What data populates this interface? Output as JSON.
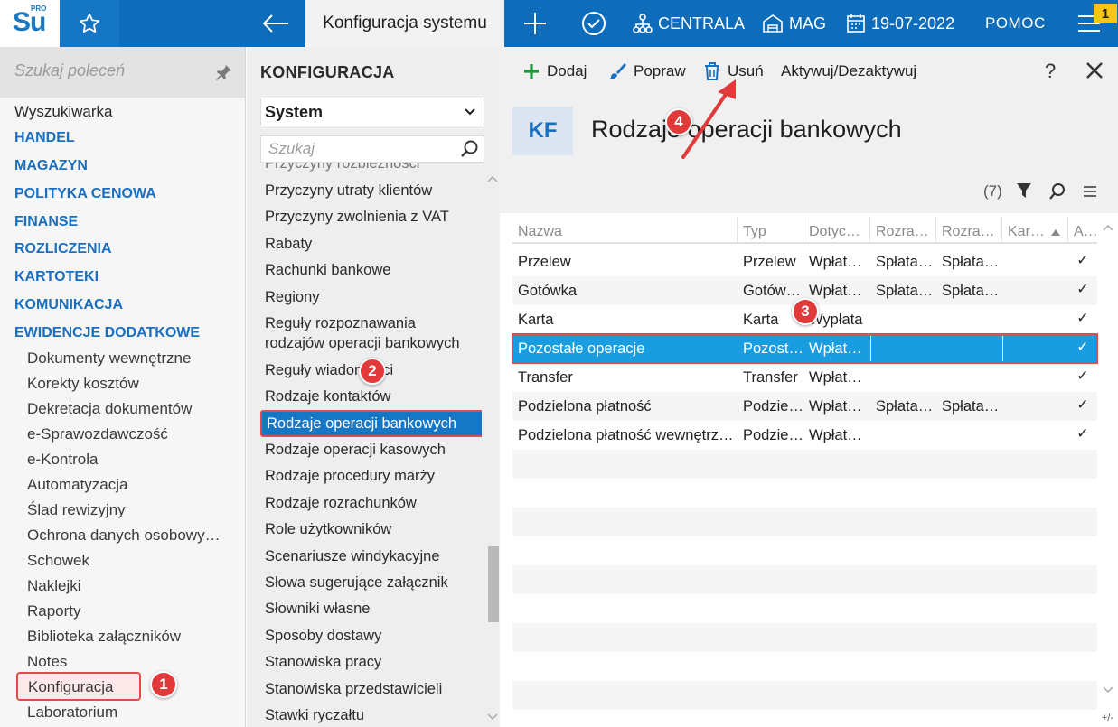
{
  "topbar": {
    "logo_text": "Su",
    "logo_superscript": "PRO",
    "title": "Konfiguracja systemu",
    "centrala": "CENTRALA",
    "mag": "MAG",
    "date": "19-07-2022",
    "help": "POMOC",
    "notification_count": "1"
  },
  "sidebar": {
    "search_placeholder": "Szukaj poleceń",
    "items": [
      {
        "label": "Wyszukiwarka"
      },
      {
        "label": "HANDEL"
      },
      {
        "label": "MAGAZYN"
      },
      {
        "label": "POLITYKA CENOWA"
      },
      {
        "label": "FINANSE"
      },
      {
        "label": "ROZLICZENIA"
      },
      {
        "label": "KARTOTEKI"
      },
      {
        "label": "KOMUNIKACJA"
      },
      {
        "label": "EWIDENCJE DODATKOWE"
      },
      {
        "label": "Dokumenty wewnętrzne"
      },
      {
        "label": "Korekty kosztów"
      },
      {
        "label": "Dekretacja dokumentów"
      },
      {
        "label": "e-Sprawozdawczość"
      },
      {
        "label": "e-Kontrola"
      },
      {
        "label": "Automatyzacja"
      },
      {
        "label": "Ślad rewizyjny"
      },
      {
        "label": "Ochrona danych osobowy…"
      },
      {
        "label": "Schowek"
      },
      {
        "label": "Naklejki"
      },
      {
        "label": "Raporty"
      },
      {
        "label": "Biblioteka załączników"
      },
      {
        "label": "Notes"
      },
      {
        "label": "Konfiguracja"
      },
      {
        "label": "Laboratorium"
      }
    ]
  },
  "config": {
    "title": "KONFIGURACJA",
    "selected_group": "System",
    "search_placeholder": "Szukaj",
    "items": [
      {
        "label": "Przyczyny rozbieżności"
      },
      {
        "label": "Przyczyny utraty klientów"
      },
      {
        "label": "Przyczyny zwolnienia z VAT"
      },
      {
        "label": "Rabaty"
      },
      {
        "label": "Rachunki bankowe"
      },
      {
        "label": "Regiony"
      },
      {
        "label": "Reguły rozpoznawania"
      },
      {
        "label": "rodzajów operacji bankowych"
      },
      {
        "label": "Reguły wiadomości"
      },
      {
        "label": "Rodzaje kontaktów"
      },
      {
        "label": "Rodzaje operacji bankowych"
      },
      {
        "label": "Rodzaje operacji kasowych"
      },
      {
        "label": "Rodzaje procedury marży"
      },
      {
        "label": "Rodzaje rozrachunków"
      },
      {
        "label": "Role użytkowników"
      },
      {
        "label": "Scenariusze windykacyjne"
      },
      {
        "label": "Słowa sugerujące załącznik"
      },
      {
        "label": "Słowniki własne"
      },
      {
        "label": "Sposoby dostawy"
      },
      {
        "label": "Stanowiska pracy"
      },
      {
        "label": "Stanowiska przedstawicieli"
      },
      {
        "label": "Stawki ryczałtu"
      }
    ]
  },
  "toolbar": {
    "add": "Dodaj",
    "edit": "Popraw",
    "delete": "Usuń",
    "toggle_active": "Aktywuj/Dezaktywuj",
    "help": "?"
  },
  "main": {
    "badge": "KF",
    "title": "Rodzaje operacji bankowych",
    "count": "(7)"
  },
  "grid": {
    "columns": [
      "Nazwa",
      "Typ",
      "Dotyc…",
      "Rozra…",
      "Rozra…",
      "Kar…",
      "A…"
    ],
    "rows": [
      {
        "nazwa": "Przelew",
        "typ": "Przelew",
        "dotyczy": "Wpłat…",
        "rozra1": "Spłata…",
        "rozra2": "Spłata…",
        "kar": "",
        "active": "✓"
      },
      {
        "nazwa": "Gotówka",
        "typ": "Gotów…",
        "dotyczy": "Wpłat…",
        "rozra1": "Spłata…",
        "rozra2": "Spłata…",
        "kar": "",
        "active": "✓"
      },
      {
        "nazwa": "Karta",
        "typ": "Karta",
        "dotyczy": "Wypłata",
        "rozra1": "",
        "rozra2": "",
        "kar": "",
        "active": "✓"
      },
      {
        "nazwa": "Pozostałe operacje",
        "typ": "Pozost…",
        "dotyczy": "Wpłat…",
        "rozra1": "",
        "rozra2": "",
        "kar": "",
        "active": "✓"
      },
      {
        "nazwa": "Transfer",
        "typ": "Transfer",
        "dotyczy": "Wpłat…",
        "rozra1": "",
        "rozra2": "",
        "kar": "",
        "active": "✓"
      },
      {
        "nazwa": "Podzielona płatność",
        "typ": "Podzie…",
        "dotyczy": "Wpłat…",
        "rozra1": "Spłata…",
        "rozra2": "Spłata…",
        "kar": "",
        "active": "✓"
      },
      {
        "nazwa": "Podzielona płatność wewnętrz…",
        "typ": "Podzie…",
        "dotyczy": "Wpłat…",
        "rozra1": "",
        "rozra2": "",
        "kar": "",
        "active": "✓"
      }
    ],
    "footer_toggle": "+/-"
  },
  "markers": {
    "m1": "1",
    "m2": "2",
    "m3": "3",
    "m4": "4"
  },
  "colors": {
    "brand_blue": "#0d6dbb",
    "selected_blue": "#1a9de0",
    "highlight_red": "#e04c4c",
    "badge_yellow": "#f7c515"
  }
}
